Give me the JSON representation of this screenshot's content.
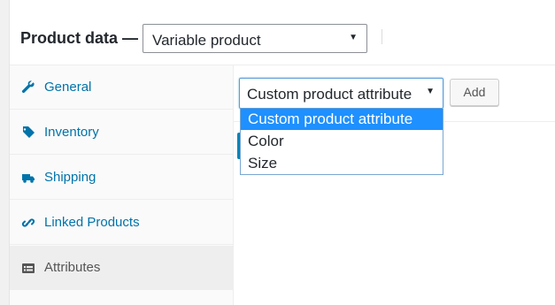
{
  "header": {
    "title": "Product data —",
    "product_type": "Variable product"
  },
  "tabs": [
    {
      "label": "General",
      "icon": "wrench-icon"
    },
    {
      "label": "Inventory",
      "icon": "tag-icon"
    },
    {
      "label": "Shipping",
      "icon": "truck-icon"
    },
    {
      "label": "Linked Products",
      "icon": "link-icon"
    },
    {
      "label": "Attributes",
      "icon": "list-view-icon"
    }
  ],
  "active_tab": "Attributes",
  "attributes": {
    "select_value": "Custom product attribute",
    "add_label": "Add",
    "options": [
      "Custom product attribute",
      "Color",
      "Size"
    ],
    "highlighted_option": "Custom product attribute"
  },
  "colors": {
    "link": "#0073aa",
    "highlight": "#1e90ff",
    "focus_border": "#5b9dd9"
  }
}
